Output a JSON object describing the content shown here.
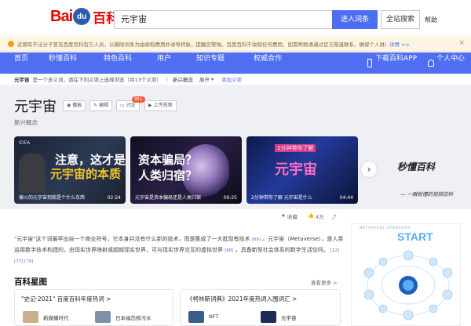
{
  "header": {
    "logo": {
      "bai": "Bai",
      "paw": "du",
      "du": "",
      "baike": "百科"
    },
    "search_value": "元宇宙",
    "enter_button": "进入词条",
    "site_search_button": "全站搜索",
    "help_link": "帮助"
  },
  "notice": {
    "text": "近期有不法分子冒充百度百科官方人员，以删除词条为由收取费用并诱导转账，提醒您警惕。百度百科不收取任何费用，如需帮助请通过官方渠道联系，确保个人财产安全。",
    "more": "详情 >>",
    "close": "×"
  },
  "nav": {
    "items": [
      "首页",
      "秒懂百科",
      "特色百科",
      "用户",
      "知识专题",
      "权威合作"
    ],
    "app": "下载百科APP",
    "center": "个人中心"
  },
  "breadcrumb": {
    "term": "元宇宙",
    "desc": "是一个多义词，请在下列义项上选择浏览（共13个义项）",
    "sense": "新兴概念",
    "sep": "|",
    "more": "展开",
    "add": "添加义项"
  },
  "title": {
    "main": "元宇宙",
    "buttons": [
      "播报",
      "编辑",
      "讨论",
      "上传视频"
    ],
    "badge": "99+",
    "subtitle": "新兴概念"
  },
  "media": {
    "cards": [
      {
        "big1": "注意，这才是",
        "big2": "元宇宙的本质",
        "caption": "爆火的元宇宙到底是个什么东西",
        "duration": "02:24",
        "tag": "IDEA"
      },
      {
        "big1": "资本骗局？",
        "big2": "人类归宿？",
        "caption": "元宇宙是资本骗局还是人类归宿",
        "duration": "09:25"
      },
      {
        "big1": "元宇宙",
        "big2": "",
        "caption": "2分钟带你了解 元宇宙是什么",
        "duration": "04:44",
        "top": "2分钟带你了解"
      }
    ],
    "slogan": "秒懂百科",
    "slogan_sub": "— 一眼就懂的视频百科"
  },
  "stats": {
    "collect": "收藏",
    "likes": "4万",
    "shares": "分享"
  },
  "summary": {
    "p1": "\"元宇宙\"这个词最早出自一个商业符号，它本身并没有什么新的技术，而是集成了一大批现有技术",
    "r1": "[69]",
    "p2": "。元宇宙（Metaverse），是人类运用数字技术构建的，由现实世界映射或超越现实世界，可与现实世界交互的虚拟世界",
    "r2": "[68]",
    "p3": "，具备新型社会体系的数字生活空间。",
    "r3": "[12] [77] [79]"
  },
  "section": {
    "title": "百科星图",
    "more": "查看更多 >"
  },
  "panels": [
    {
      "title": "\"史记·2021\" 百度百科年度热词 >",
      "items": [
        "新媒播时代",
        "日本福岛核污水"
      ]
    },
    {
      "title": "《柯林斯词典》2021年度热词入围词汇 >",
      "items": [
        "NFT",
        "元宇宙"
      ]
    }
  ],
  "infographic": {
    "start": "START",
    "head": "METAVERSE PANORAMA"
  },
  "colors": {
    "brand": "#4f6ef2",
    "logo_red": "#e10601",
    "notice_bg": "#fcf5e3"
  }
}
